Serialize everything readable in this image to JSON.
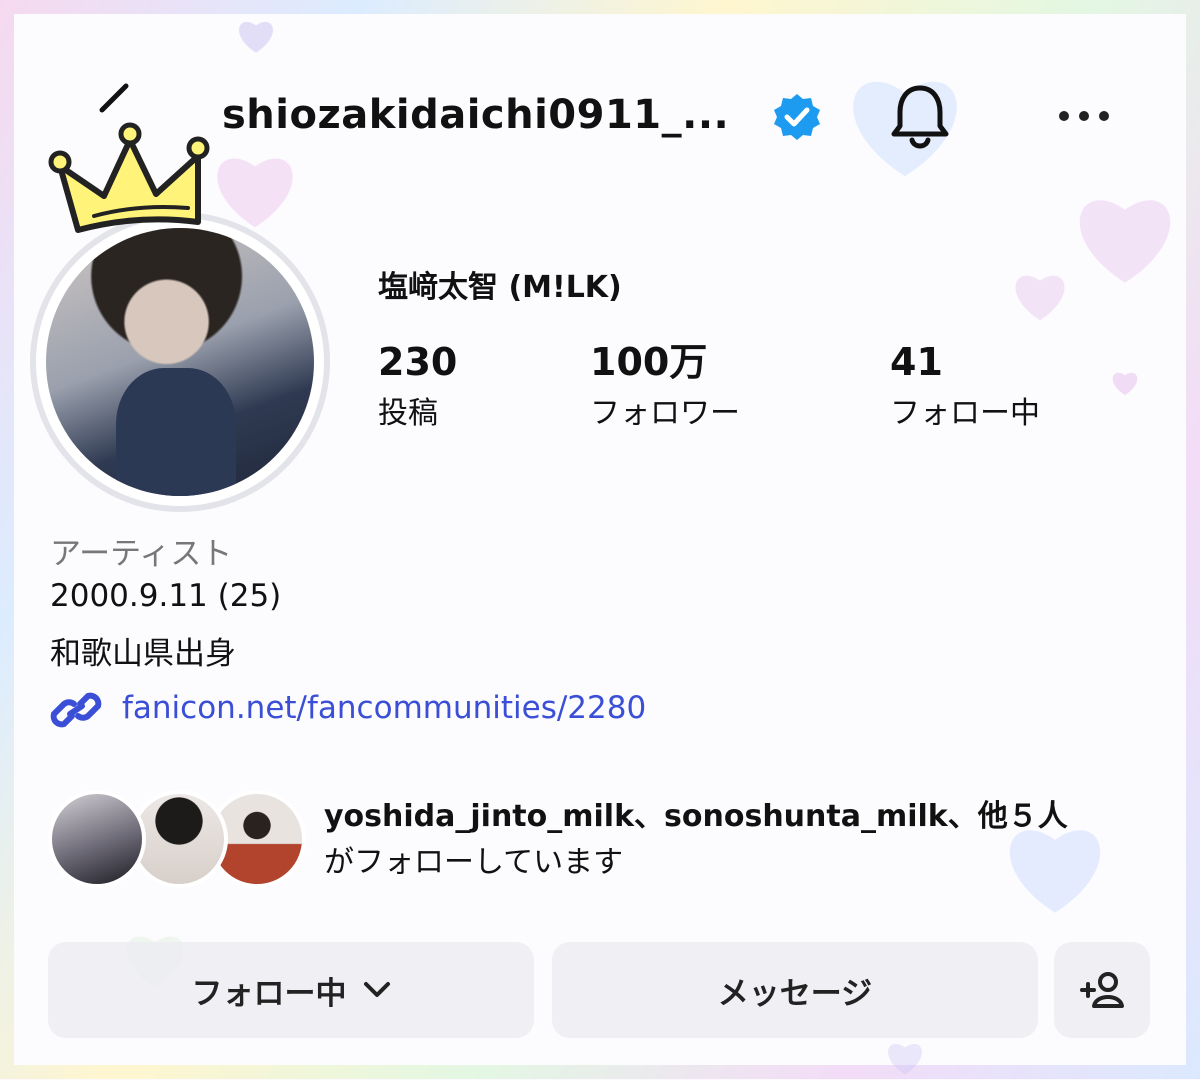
{
  "header": {
    "username": "shiozakidaichi0911_...",
    "verified": true
  },
  "profile": {
    "display_name": "塩﨑太智 (M!LK)",
    "stats": [
      {
        "value": "230",
        "label": "投稿"
      },
      {
        "value": "100万",
        "label": "フォロワー"
      },
      {
        "value": "41",
        "label": "フォロー中"
      }
    ],
    "category": "アーティスト",
    "bio_lines": [
      "2000.9.11 (25)",
      "和歌山県出身"
    ],
    "link": "fanicon.net/fancommunities/2280"
  },
  "followed_by": {
    "names": "yoshida_jinto_milk、sonoshunta_milk、他５人",
    "suffix": "がフォローしています"
  },
  "actions": {
    "follow_label": "フォロー中",
    "message_label": "メッセージ"
  },
  "icons": {
    "back": "back-arrow-icon",
    "verified": "verified-badge-icon",
    "bell": "bell-icon",
    "more": "more-dots-icon",
    "link": "link-icon",
    "add_person": "add-person-icon",
    "crown": "crown-sticker"
  },
  "colors": {
    "verified_blue": "#1d9bf0",
    "link_blue": "#3a4fd6",
    "button_bg": "#ececf2",
    "crown_yellow": "#fff37a"
  }
}
